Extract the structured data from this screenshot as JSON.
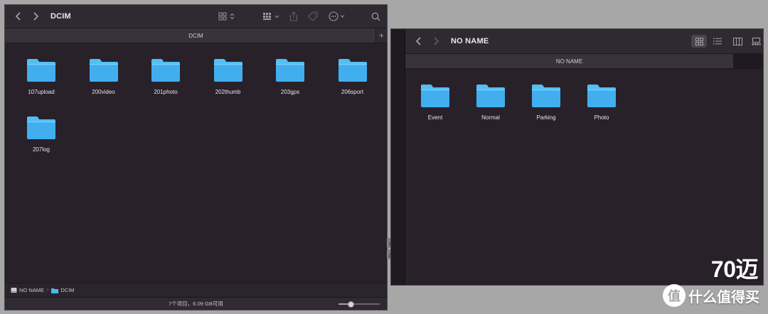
{
  "left_window": {
    "title": "DCIM",
    "tab": "DCIM",
    "new_tab_glyph": "+",
    "folders": [
      "107upload",
      "200video",
      "201photo",
      "202thumb",
      "203gps",
      "206sport",
      "207log"
    ],
    "path": [
      "NO NAME",
      "DCIM"
    ],
    "path_separator": "›",
    "status": "7个项目，6.09 GB可用",
    "icon_size_fraction": 0.3
  },
  "right_window": {
    "title": "NO NAME",
    "tab": "NO NAME",
    "folders": [
      "Event",
      "Normal",
      "Parking",
      "Photo"
    ]
  },
  "watermark": {
    "big": "70迈",
    "logo_glyph": "值",
    "small": "什么值得买"
  },
  "colors": {
    "window_bg": "#28212a",
    "folder_top": "#52bff2",
    "folder_body": "#41aef0"
  },
  "icons": [
    "chevron-left-icon",
    "chevron-right-icon",
    "icon-view-icon",
    "group-icon",
    "share-icon",
    "tag-icon",
    "more-icon",
    "search-icon",
    "list-view-icon",
    "column-view-icon",
    "gallery-view-icon",
    "drive-icon",
    "folder-icon",
    "eject-icon"
  ]
}
